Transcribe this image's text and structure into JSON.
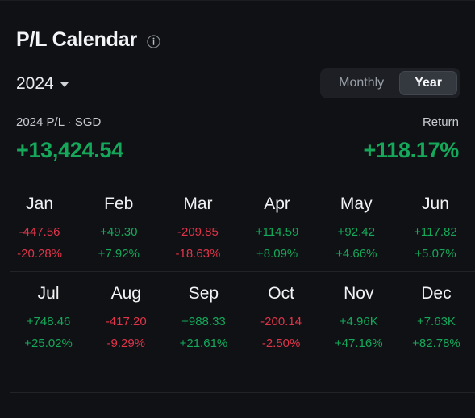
{
  "header": {
    "title": "P/L Calendar",
    "info_icon": "info-circle-icon"
  },
  "controls": {
    "year": "2024",
    "caret_icon": "chevron-down-icon",
    "toggle": {
      "options": [
        "Monthly",
        "Year"
      ],
      "selected": "Year"
    }
  },
  "summary": {
    "pl_label": "2024 P/L · SGD",
    "pl_value": "+13,424.54",
    "pl_sign": "pos",
    "return_label": "Return",
    "return_value": "+118.17%",
    "return_sign": "pos"
  },
  "colors": {
    "positive": "#15a85a",
    "negative": "#e0344a",
    "background": "#0f1114",
    "toggle_active": "#34383f"
  },
  "months": [
    {
      "name": "Jan",
      "pl": "-447.56",
      "ret": "-20.28%",
      "sign": "neg"
    },
    {
      "name": "Feb",
      "pl": "+49.30",
      "ret": "+7.92%",
      "sign": "pos"
    },
    {
      "name": "Mar",
      "pl": "-209.85",
      "ret": "-18.63%",
      "sign": "neg"
    },
    {
      "name": "Apr",
      "pl": "+114.59",
      "ret": "+8.09%",
      "sign": "pos"
    },
    {
      "name": "May",
      "pl": "+92.42",
      "ret": "+4.66%",
      "sign": "pos"
    },
    {
      "name": "Jun",
      "pl": "+117.82",
      "ret": "+5.07%",
      "sign": "pos"
    },
    {
      "name": "Jul",
      "pl": "+748.46",
      "ret": "+25.02%",
      "sign": "pos"
    },
    {
      "name": "Aug",
      "pl": "-417.20",
      "ret": "-9.29%",
      "sign": "neg"
    },
    {
      "name": "Sep",
      "pl": "+988.33",
      "ret": "+21.61%",
      "sign": "pos"
    },
    {
      "name": "Oct",
      "pl": "-200.14",
      "ret": "-2.50%",
      "sign": "neg"
    },
    {
      "name": "Nov",
      "pl": "+4.96K",
      "ret": "+47.16%",
      "sign": "pos"
    },
    {
      "name": "Dec",
      "pl": "+7.63K",
      "ret": "+82.78%",
      "sign": "pos"
    }
  ]
}
